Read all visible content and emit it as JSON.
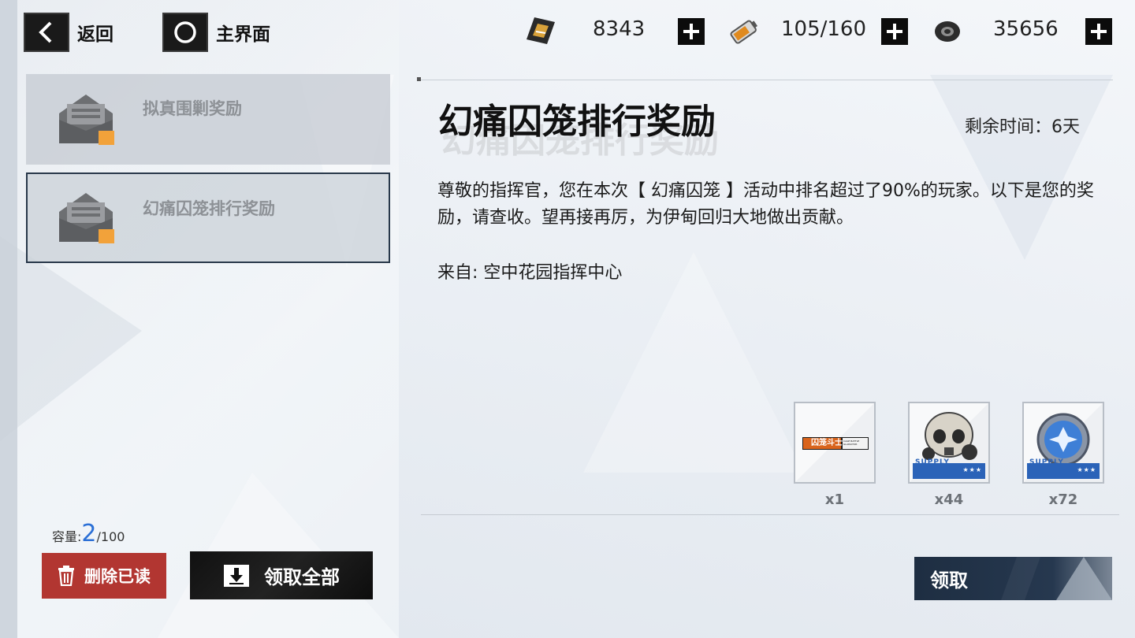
{
  "nav": {
    "back_label": "返回",
    "home_label": "主界面"
  },
  "resources": [
    {
      "icon": "ticket-icon",
      "value": "8343"
    },
    {
      "icon": "battery-icon",
      "value": "105/160"
    },
    {
      "icon": "gear-nut-icon",
      "value": "35656"
    }
  ],
  "mail_list": [
    {
      "title": "拟真围剿奖励"
    },
    {
      "title": "幻痛囚笼排行奖励"
    }
  ],
  "capacity": {
    "label": "容量:",
    "current": "2",
    "max": "/100"
  },
  "buttons": {
    "delete_read": "删除已读",
    "claim_all": "领取全部",
    "claim": "领取"
  },
  "detail": {
    "title": "幻痛囚笼排行奖励",
    "remaining": "剩余时间：6天",
    "body": "尊敬的指挥官，您在本次【 幻痛囚笼 】活动中排名超过了90%的玩家。以下是您的奖励，请查收。望再接再厉，为伊甸回归大地做出贡献。",
    "from": "来自: 空中花园指挥中心"
  },
  "rewards": [
    {
      "name": "cage-fighter-badge",
      "label": "囚笼斗士",
      "sublabel": "CAGE BATTLE GLADIATOR",
      "qty": "x1"
    },
    {
      "name": "skull-mask-supply",
      "tag": "SUPPLY",
      "stars": "★★★",
      "qty": "x44"
    },
    {
      "name": "blue-crystal-coin-supply",
      "tag": "SUPPLY",
      "stars": "★★★",
      "qty": "x72"
    }
  ],
  "colors": {
    "accent_blue": "#2b6fd6",
    "delete_red": "#b23631",
    "claim_navy": "#1e2e42"
  }
}
